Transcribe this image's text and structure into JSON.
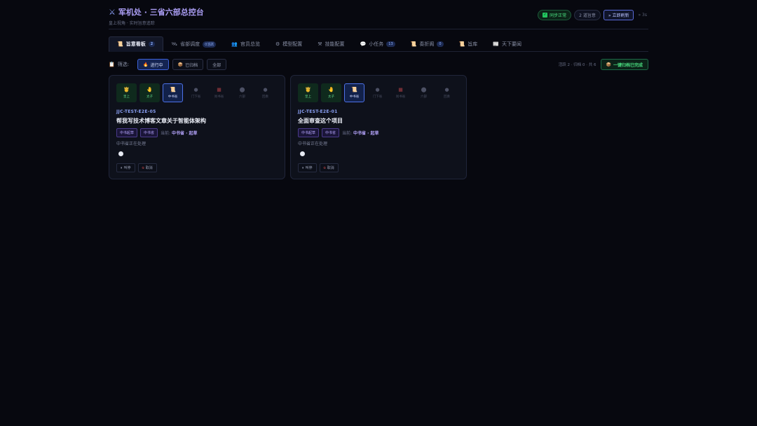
{
  "header": {
    "title": "军机处 · 三省六部总控台",
    "subtitle": "皇上视角 · 实时旨意追踪",
    "sync_status": "同步正常",
    "alerts": "2 道旨意",
    "refresh_button": "» 立即刷新",
    "interval": "» 3s"
  },
  "tabs": [
    {
      "icon": "📜",
      "label": "旨意看板",
      "badge": "2"
    },
    {
      "icon": "🛰",
      "label": "省部调度",
      "badge": "0活跃"
    },
    {
      "icon": "👥",
      "label": "官员总览",
      "badge": ""
    },
    {
      "icon": "⚙",
      "label": "模型配置",
      "badge": ""
    },
    {
      "icon": "⚒",
      "label": "技能配置",
      "badge": ""
    },
    {
      "icon": "💬",
      "label": "小任务",
      "badge": "13"
    },
    {
      "icon": "📜",
      "label": "奏折阁",
      "badge": "0"
    },
    {
      "icon": "📜",
      "label": "旨库",
      "badge": ""
    },
    {
      "icon": "📰",
      "label": "天下要闻",
      "badge": ""
    }
  ],
  "filter": {
    "label": "筛选:",
    "options": [
      "进行中",
      "已归档",
      "全部"
    ],
    "option_icons": [
      "🔥",
      "📦",
      ""
    ],
    "active": "进行中",
    "stats": "活跃 2 · 归档 0 · 共 6",
    "archive_button": "一键归档已完成"
  },
  "stage_names": [
    "皇上",
    "太子",
    "中书省",
    "门下省",
    "尚书省",
    "六部",
    "回奏"
  ],
  "cards": [
    {
      "code": "JJC-TEST-E2E-05",
      "title": "帮我写技术博客文章关于智能体架构",
      "tags": [
        "中书起草",
        "中书省"
      ],
      "current_label": "当前:",
      "current_value": "中书省 · 起草",
      "status_text": "中书省正在处理",
      "actions": [
        "叫停",
        "取消"
      ]
    },
    {
      "code": "JJC-TEST-E2E-01",
      "title": "全面审查这个项目",
      "tags": [
        "中书起草",
        "中书省"
      ],
      "current_label": "当前:",
      "current_value": "中书省 · 起草",
      "status_text": "中书省正在处理",
      "actions": [
        "叫停",
        "取消"
      ]
    }
  ]
}
